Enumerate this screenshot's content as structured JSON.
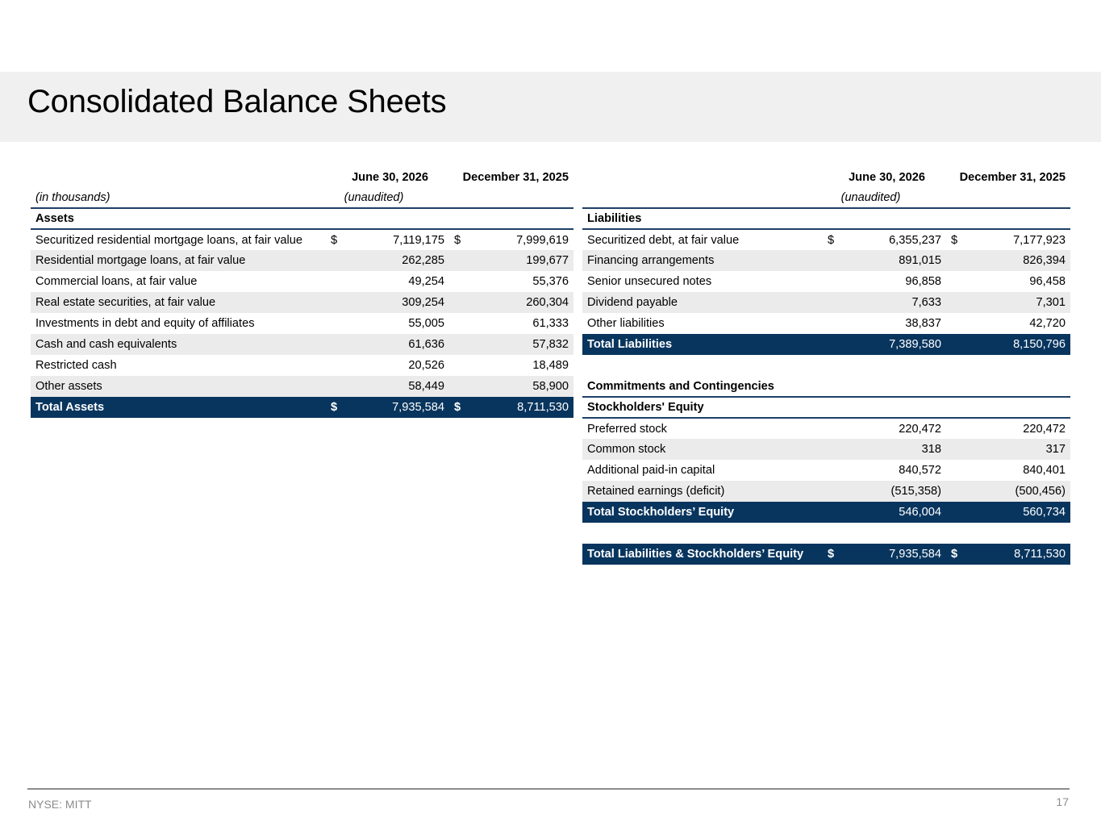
{
  "title": "Consolidated Balance Sheets",
  "colors": {
    "band": "#f0f0f0",
    "total_fill": "#08355e",
    "rule": "#1e3f66",
    "row_shade": "#ebebeb"
  },
  "assets": {
    "col1": "June 30, 2026",
    "col2": "December 31, 2025",
    "units": "(in thousands)",
    "unaudited": "(unaudited)",
    "section": "Assets",
    "rows": [
      {
        "label": "Securitized residential mortgage loans, at fair value",
        "d1": "$",
        "v1": "7,119,175",
        "d2": "$",
        "v2": "7,999,619"
      },
      {
        "label": "Residential mortgage loans, at fair value",
        "v1": "262,285",
        "v2": "199,677"
      },
      {
        "label": "Commercial loans, at fair value",
        "v1": "49,254",
        "v2": "55,376"
      },
      {
        "label": "Real estate securities, at fair value",
        "v1": "309,254",
        "v2": "260,304"
      },
      {
        "label": "Investments in debt and equity of affiliates",
        "v1": "55,005",
        "v2": "61,333"
      },
      {
        "label": "Cash and cash equivalents",
        "v1": "61,636",
        "v2": "57,832"
      },
      {
        "label": "Restricted cash",
        "v1": "20,526",
        "v2": "18,489"
      },
      {
        "label": "Other assets",
        "v1": "58,449",
        "v2": "58,900"
      }
    ],
    "total": {
      "label": "Total Assets",
      "d1": "$",
      "v1": "7,935,584",
      "d2": "$",
      "v2": "8,711,530"
    }
  },
  "liabilities": {
    "col1": "June 30, 2026",
    "col2": "December 31, 2025",
    "unaudited": "(unaudited)",
    "section": "Liabilities",
    "rows": [
      {
        "label": "Securitized debt, at fair value",
        "d1": "$",
        "v1": "6,355,237",
        "d2": "$",
        "v2": "7,177,923"
      },
      {
        "label": "Financing arrangements",
        "v1": "891,015",
        "v2": "826,394"
      },
      {
        "label": "Senior unsecured notes",
        "v1": "96,858",
        "v2": "96,458"
      },
      {
        "label": "Dividend payable",
        "v1": "7,633",
        "v2": "7,301"
      },
      {
        "label": "Other liabilities",
        "v1": "38,837",
        "v2": "42,720"
      }
    ],
    "total": {
      "label": "Total Liabilities",
      "v1": "7,389,580",
      "v2": "8,150,796"
    },
    "commitments": "Commitments and Contingencies",
    "equity_section": "Stockholders' Equity",
    "equity_rows": [
      {
        "label": "Preferred stock",
        "v1": "220,472",
        "v2": "220,472"
      },
      {
        "label": "Common stock",
        "v1": "318",
        "v2": "317"
      },
      {
        "label": "Additional paid-in capital",
        "v1": "840,572",
        "v2": "840,401"
      },
      {
        "label": "Retained earnings (deficit)",
        "v1": "(515,358)",
        "v2": "(500,456)"
      }
    ],
    "equity_total": {
      "label": "Total Stockholders’ Equity",
      "v1": "546,004",
      "v2": "560,734"
    },
    "grand_total": {
      "label": "Total Liabilities & Stockholders’ Equity",
      "d1": "$",
      "v1": "7,935,584",
      "d2": "$",
      "v2": "8,711,530"
    }
  },
  "footer": {
    "ticker": "NYSE: MITT",
    "page": "17"
  }
}
